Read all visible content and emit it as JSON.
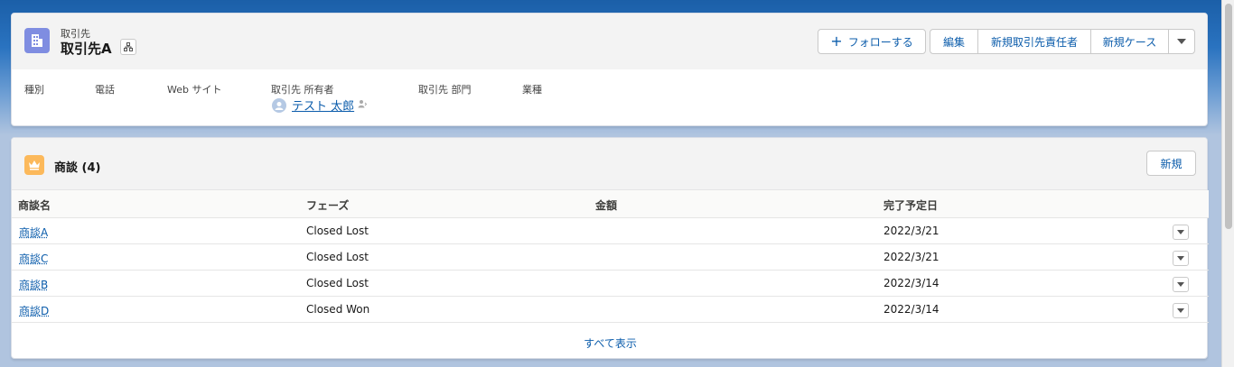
{
  "record": {
    "object_label": "取引先",
    "title": "取引先A",
    "icon": "account-icon"
  },
  "actions": {
    "follow": "フォローする",
    "edit": "編集",
    "new_contact": "新規取引先責任者",
    "new_case": "新規ケース"
  },
  "highlights": {
    "fields": [
      {
        "label": "種別",
        "value": ""
      },
      {
        "label": "電話",
        "value": ""
      },
      {
        "label": "Web サイト",
        "value": ""
      },
      {
        "label": "取引先 所有者",
        "value": "テスト 太郎"
      },
      {
        "label": "取引先 部門",
        "value": ""
      },
      {
        "label": "業種",
        "value": ""
      }
    ]
  },
  "related_list": {
    "title": "商談 (4)",
    "new_label": "新規",
    "view_all": "すべて表示",
    "columns": [
      "商談名",
      "フェーズ",
      "金額",
      "完了予定日"
    ],
    "rows": [
      {
        "name": "商談A",
        "stage": "Closed Lost",
        "amount": "",
        "close_date": "2022/3/21"
      },
      {
        "name": "商談C",
        "stage": "Closed Lost",
        "amount": "",
        "close_date": "2022/3/21"
      },
      {
        "name": "商談B",
        "stage": "Closed Lost",
        "amount": "",
        "close_date": "2022/3/14"
      },
      {
        "name": "商談D",
        "stage": "Closed Won",
        "amount": "",
        "close_date": "2022/3/14"
      }
    ]
  },
  "colors": {
    "brand_link": "#0b5cab",
    "account_icon_bg": "#7f8de1",
    "opportunity_icon_bg": "#fcb95b"
  }
}
